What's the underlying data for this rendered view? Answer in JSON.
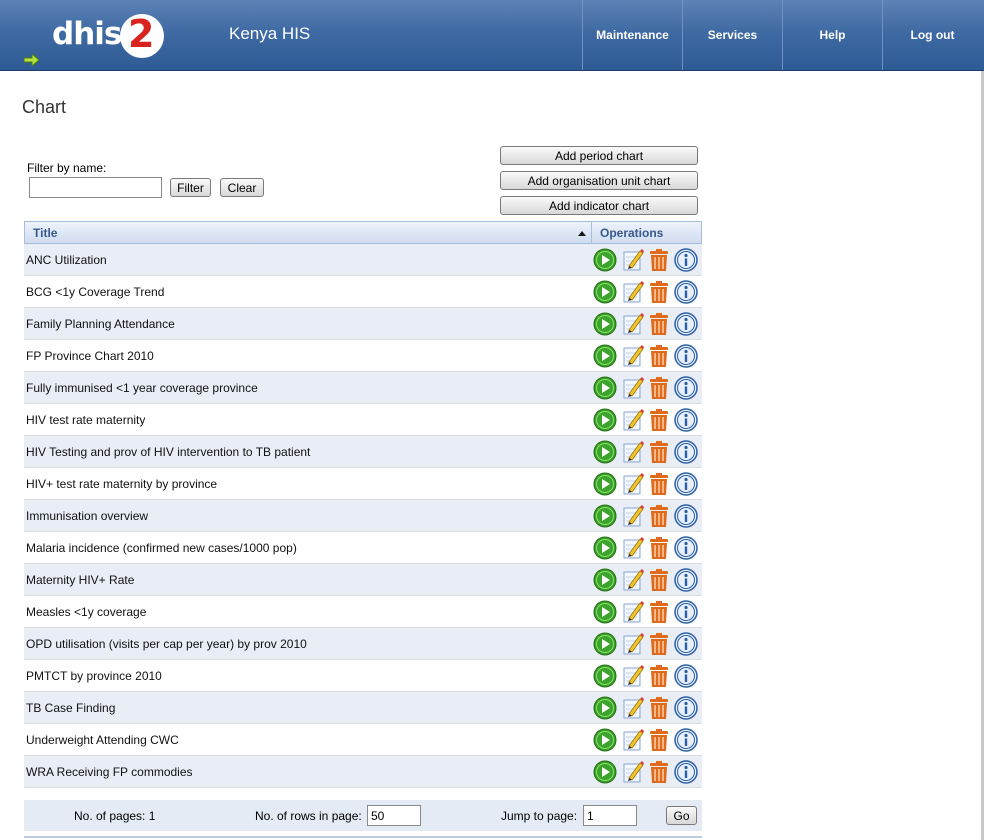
{
  "header": {
    "logo_text": "dhis",
    "logo_number": "2",
    "app_title": "Kenya HIS",
    "nav": [
      "Maintenance",
      "Services",
      "Help",
      "Log out"
    ]
  },
  "page": {
    "title": "Chart"
  },
  "filter": {
    "label": "Filter by name:",
    "value": "",
    "filter_button": "Filter",
    "clear_button": "Clear"
  },
  "actions": {
    "add_period": "Add period chart",
    "add_orgunit": "Add organisation unit chart",
    "add_indicator": "Add indicator chart"
  },
  "table": {
    "col_title": "Title",
    "col_operations": "Operations",
    "rows": [
      "ANC Utilization",
      "BCG <1y Coverage Trend",
      "Family Planning Attendance",
      "FP Province Chart 2010",
      "Fully immunised <1 year coverage province",
      "HIV test rate maternity",
      "HIV Testing and prov of HIV intervention to TB patient",
      "HIV+ test rate maternity by province",
      "Immunisation overview",
      "Malaria incidence (confirmed new cases/1000 pop)",
      "Maternity HIV+ Rate",
      "Measles <1y coverage",
      "OPD utilisation (visits per cap per year) by prov 2010",
      "PMTCT by province 2010",
      "TB Case Finding",
      "Underweight Attending CWC",
      "WRA Receiving FP commodies"
    ]
  },
  "pager": {
    "pages_label": "No. of pages: 1",
    "rows_label": "No. of rows in page:",
    "rows_value": "50",
    "jump_label": "Jump to page:",
    "jump_value": "1",
    "go_button": "Go"
  },
  "colors": {
    "header": "#3f6aa3",
    "row_alt": "#e8edf6",
    "run_icon": "#3aa329",
    "delete_icon": "#e06a1c",
    "info_icon": "#2d5fa5"
  }
}
